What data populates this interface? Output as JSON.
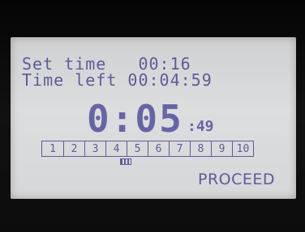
{
  "display": {
    "set_time_label": "Set time",
    "set_time_value": "00:16",
    "time_left_label": "Time left",
    "time_left_value": "00:04:59",
    "big_time": "0:05",
    "big_seconds": ":49",
    "steps": [
      "1",
      "2",
      "3",
      "4",
      "5",
      "6",
      "7",
      "8",
      "9",
      "10"
    ],
    "current_step": 4,
    "proceed_label": "PROCEED"
  },
  "colors": {
    "lcd_text": "#5d5c96",
    "lcd_background": "#d6d7d9",
    "bezel": "#0a0a0a"
  }
}
